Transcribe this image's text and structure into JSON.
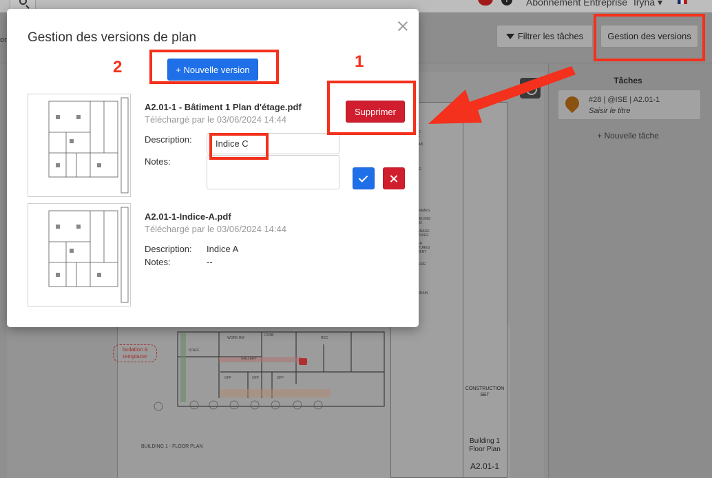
{
  "topbar": {
    "subscription_label": "Abonnement Entreprise",
    "user_label": "Iryna ▾"
  },
  "toolbar": {
    "left_partial_text": "on",
    "filter_label": "Filtrer les tâches",
    "versions_label": "Gestion des versions"
  },
  "drawing": {
    "callout_text": "Isolation à remplacer",
    "floor_plan_label": "BUILDING 1 - FLOOR PLAN",
    "room_labels": [
      "WORK RM",
      "STAFF",
      "CONF",
      "GALLERY",
      "OFF",
      "OFF",
      "OFF",
      "REC"
    ],
    "title_block": {
      "construction_set": "CONSTRUCTION SET",
      "building_title": "Building 1 Floor Plan",
      "sheet_number": "A2.01-1"
    }
  },
  "tasks_panel": {
    "title": "Tâches",
    "task": {
      "meta": "#28 | @ISE | A2.01-1",
      "title_placeholder": "Saisir le titre"
    },
    "new_task_label": "+ Nouvelle tâche"
  },
  "modal": {
    "title": "Gestion des versions de plan",
    "new_version_label": "+ Nouvelle version",
    "delete_label": "Supprimer",
    "versions": [
      {
        "file_name": "A2.01-1 - Bâtiment 1 Plan d'étage.pdf",
        "uploaded": "Téléchargé par le 03/06/2024 14:44",
        "description_label": "Description:",
        "description_value": "Indice C",
        "notes_label": "Notes:",
        "notes_value": ""
      },
      {
        "file_name": "A2.01-1-Indice-A.pdf",
        "uploaded": "Téléchargé par le 03/06/2024 14:44",
        "description_label": "Description:",
        "description_value": "Indice A",
        "notes_label": "Notes:",
        "notes_value": "--"
      }
    ]
  },
  "annotations": {
    "step1": "1",
    "step2": "2",
    "color": "#f3311c"
  }
}
